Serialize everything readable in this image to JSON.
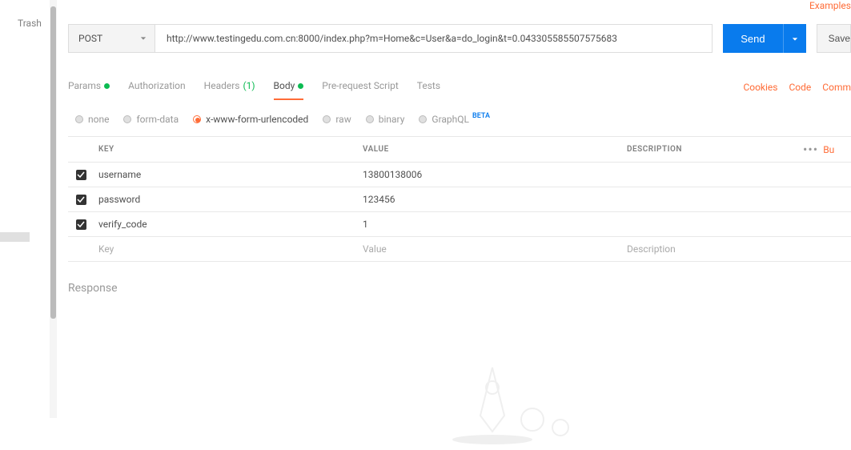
{
  "sidebar": {
    "trash_label": "Trash"
  },
  "corner": {
    "examples": "Examples"
  },
  "request": {
    "method": "POST",
    "url": "http://www.testingedu.com.cn:8000/index.php?m=Home&c=User&a=do_login&t=0.043305585507575683",
    "send_label": "Send",
    "save_label": "Save"
  },
  "tabs": {
    "params": "Params",
    "authorization": "Authorization",
    "headers": "Headers",
    "headers_count": "(1)",
    "body": "Body",
    "prerequest": "Pre-request Script",
    "tests": "Tests"
  },
  "right_links": {
    "cookies": "Cookies",
    "code": "Code",
    "comments": "Comm"
  },
  "body_types": {
    "none": "none",
    "form_data": "form-data",
    "x_www": "x-www-form-urlencoded",
    "raw": "raw",
    "binary": "binary",
    "graphql": "GraphQL",
    "beta": "BETA"
  },
  "table": {
    "headers": {
      "key": "KEY",
      "value": "VALUE",
      "description": "DESCRIPTION"
    },
    "rows": [
      {
        "key": "username",
        "value": "13800138006",
        "description": ""
      },
      {
        "key": "password",
        "value": "123456",
        "description": ""
      },
      {
        "key": "verify_code",
        "value": "1",
        "description": ""
      }
    ],
    "placeholder": {
      "key": "Key",
      "value": "Value",
      "description": "Description"
    },
    "bulk": "Bu"
  },
  "response": {
    "label": "Response"
  }
}
